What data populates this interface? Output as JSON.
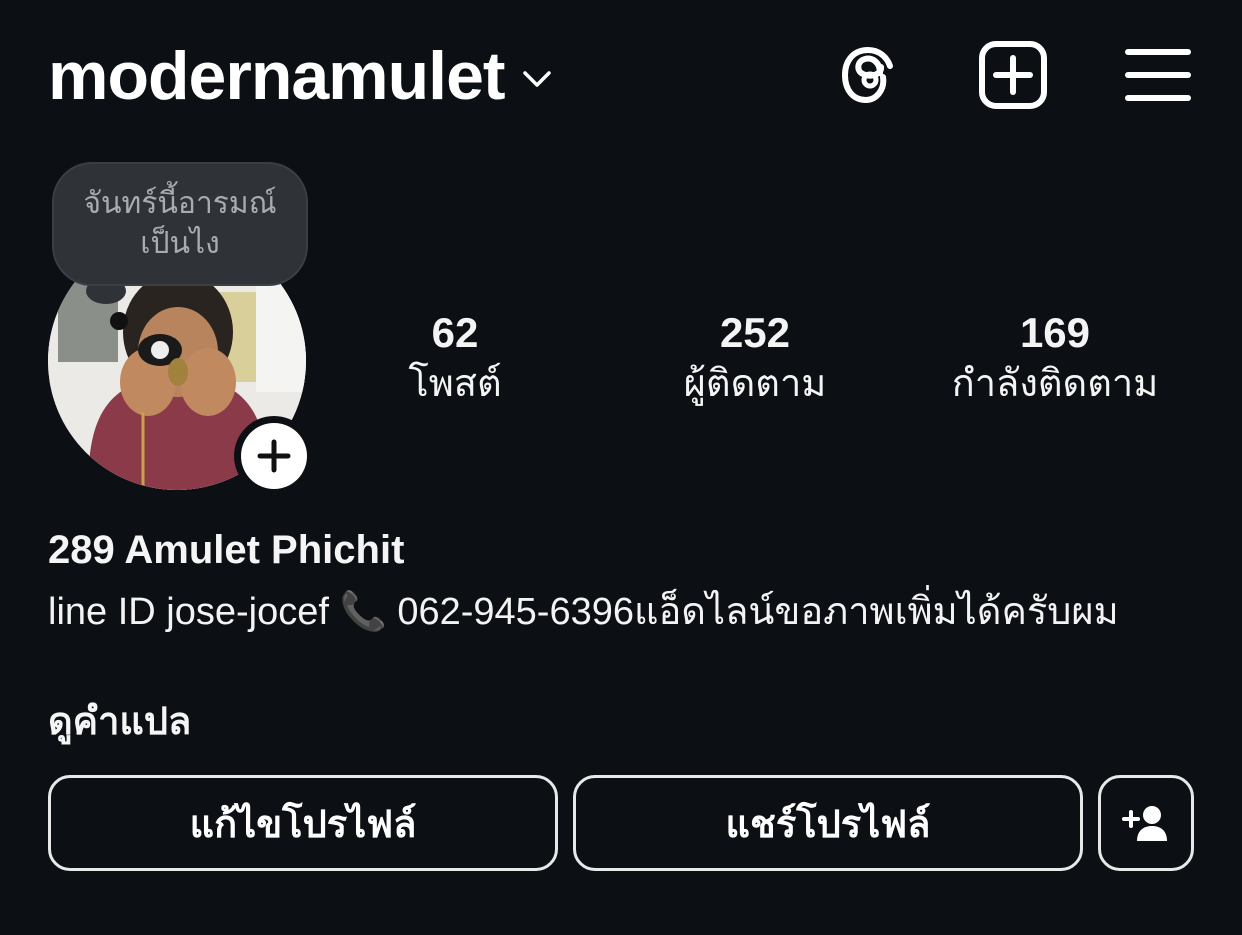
{
  "header": {
    "username": "modernamulet",
    "icons": [
      "chevron-down-icon",
      "threads-icon",
      "create-plus-icon",
      "menu-icon"
    ]
  },
  "note": {
    "line1": "จันทร์นี้อารมณ์",
    "line2": "เป็นไง"
  },
  "stats": [
    {
      "count": "62",
      "label": "โพสต์"
    },
    {
      "count": "252",
      "label": "ผู้ติดตาม"
    },
    {
      "count": "169",
      "label": "กำลังติดตาม"
    }
  ],
  "profile": {
    "display_name": "289 Amulet Phichit",
    "bio": "line ID jose-jocef 📞 062-945-6396แอ็ดไลน์ขอภาพเพิ่มได้ครับผม",
    "see_translation": "ดูคำแปล"
  },
  "buttons": {
    "edit_profile": "แก้ไขโปรไฟล์",
    "share_profile": "แชร์โปรไฟล์"
  },
  "colors": {
    "background": "#0c0f14",
    "text": "#f5f5f5",
    "note_bg": "#2f3237",
    "button_border": "#e8e8e8"
  }
}
